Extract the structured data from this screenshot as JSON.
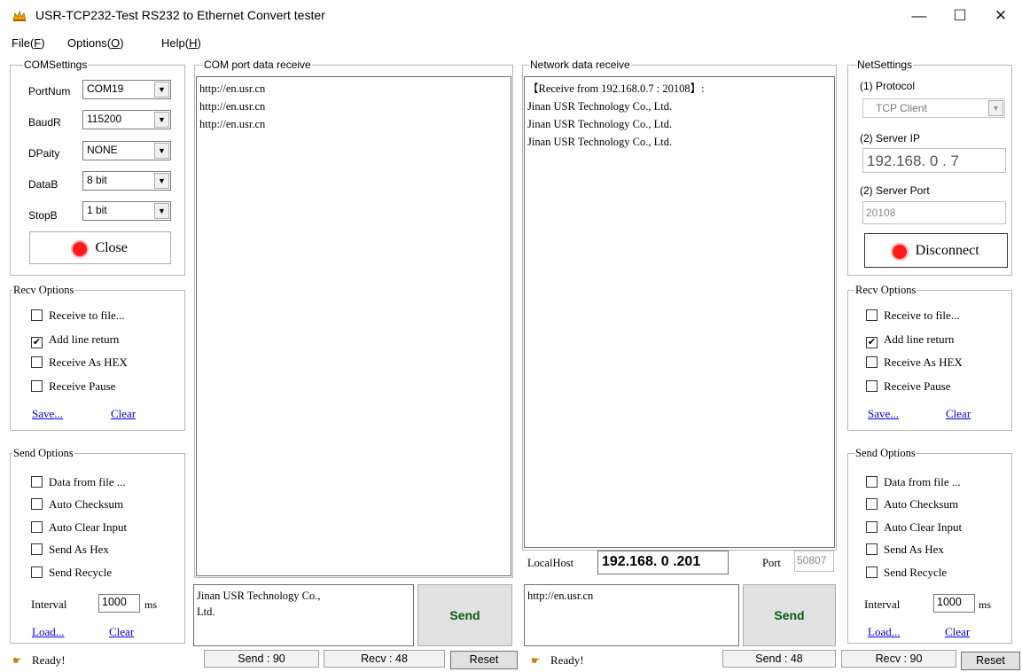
{
  "window": {
    "title": "USR-TCP232-Test  RS232 to Ethernet Convert tester",
    "minimize": "—",
    "maximize": "☐",
    "close": "✕"
  },
  "menu": [
    {
      "label": "File",
      "key": "F"
    },
    {
      "label": "Options",
      "key": "O"
    },
    {
      "label": "Help",
      "key": "H"
    }
  ],
  "com_settings": {
    "title": "COMSettings",
    "portnum_label": "PortNum",
    "portnum_value": "COM19",
    "baud_label": "BaudR",
    "baud_value": "115200",
    "parity_label": "DPaity",
    "parity_value": "NONE",
    "databits_label": "DataB",
    "databits_value": "8 bit",
    "stopbits_label": "StopB",
    "stopbits_value": "1 bit",
    "close_button": "Close"
  },
  "left_recv_options": {
    "title": "Recv Options",
    "items": [
      {
        "label": "Receive to file...",
        "checked": ""
      },
      {
        "label": "Add line return",
        "checked": "✔"
      },
      {
        "label": "Receive As HEX",
        "checked": ""
      },
      {
        "label": "Receive Pause",
        "checked": ""
      }
    ],
    "save": "Save...",
    "clear": "Clear"
  },
  "left_send_options": {
    "title": "Send Options",
    "items": [
      {
        "label": "Data from file ...",
        "checked": ""
      },
      {
        "label": "Auto Checksum",
        "checked": ""
      },
      {
        "label": "Auto Clear Input",
        "checked": ""
      },
      {
        "label": "Send As Hex",
        "checked": ""
      },
      {
        "label": "Send Recycle",
        "checked": ""
      }
    ],
    "interval_label": "Interval",
    "interval_value": "1000",
    "interval_unit": "ms",
    "load": "Load...",
    "clear": "Clear"
  },
  "com_receive": {
    "title": "COM port data receive",
    "lines": [
      "http://en.usr.cn",
      "http://en.usr.cn",
      "http://en.usr.cn"
    ]
  },
  "com_send": {
    "lines": [
      "Jinan USR Technology Co.,",
      "Ltd."
    ],
    "send_button": "Send"
  },
  "net_receive": {
    "title": "Network data receive",
    "lines": [
      "【Receive from 192.168.0.7 : 20108】:",
      "Jinan USR Technology Co., Ltd.",
      "Jinan USR Technology Co., Ltd.",
      "Jinan USR Technology Co., Ltd."
    ],
    "localhost_label": "LocalHost",
    "localhost_value": "192.168. 0 .201",
    "port_label": "Port",
    "port_value": "50807"
  },
  "net_send": {
    "lines": [
      "http://en.usr.cn"
    ],
    "send_button": "Send"
  },
  "net_settings": {
    "title": "NetSettings",
    "protocol_label": "(1) Protocol",
    "protocol_value": "TCP Client",
    "server_ip_label": "(2) Server IP",
    "server_ip_value": "192.168. 0 . 7",
    "server_port_label": "(2) Server Port",
    "server_port_value": "20108",
    "disconnect_button": "Disconnect"
  },
  "right_recv_options": {
    "title": "Recv Options",
    "items": [
      {
        "label": "Receive to file...",
        "checked": ""
      },
      {
        "label": "Add line return",
        "checked": "✔"
      },
      {
        "label": "Receive As HEX",
        "checked": ""
      },
      {
        "label": "Receive Pause",
        "checked": ""
      }
    ],
    "save": "Save...",
    "clear": "Clear"
  },
  "right_send_options": {
    "title": "Send Options",
    "items": [
      {
        "label": "Data from file ...",
        "checked": ""
      },
      {
        "label": "Auto Checksum",
        "checked": ""
      },
      {
        "label": "Auto Clear Input",
        "checked": ""
      },
      {
        "label": "Send As Hex",
        "checked": ""
      },
      {
        "label": "Send Recycle",
        "checked": ""
      }
    ],
    "interval_label": "Interval",
    "interval_value": "1000",
    "interval_unit": "ms",
    "load": "Load...",
    "clear": "Clear"
  },
  "status_left": {
    "ready": "Ready!",
    "send": "Send : 90",
    "recv": "Recv : 48",
    "reset": "Reset"
  },
  "status_right": {
    "ready": "Ready!",
    "send": "Send : 48",
    "recv": "Recv : 90",
    "reset": "Reset"
  }
}
